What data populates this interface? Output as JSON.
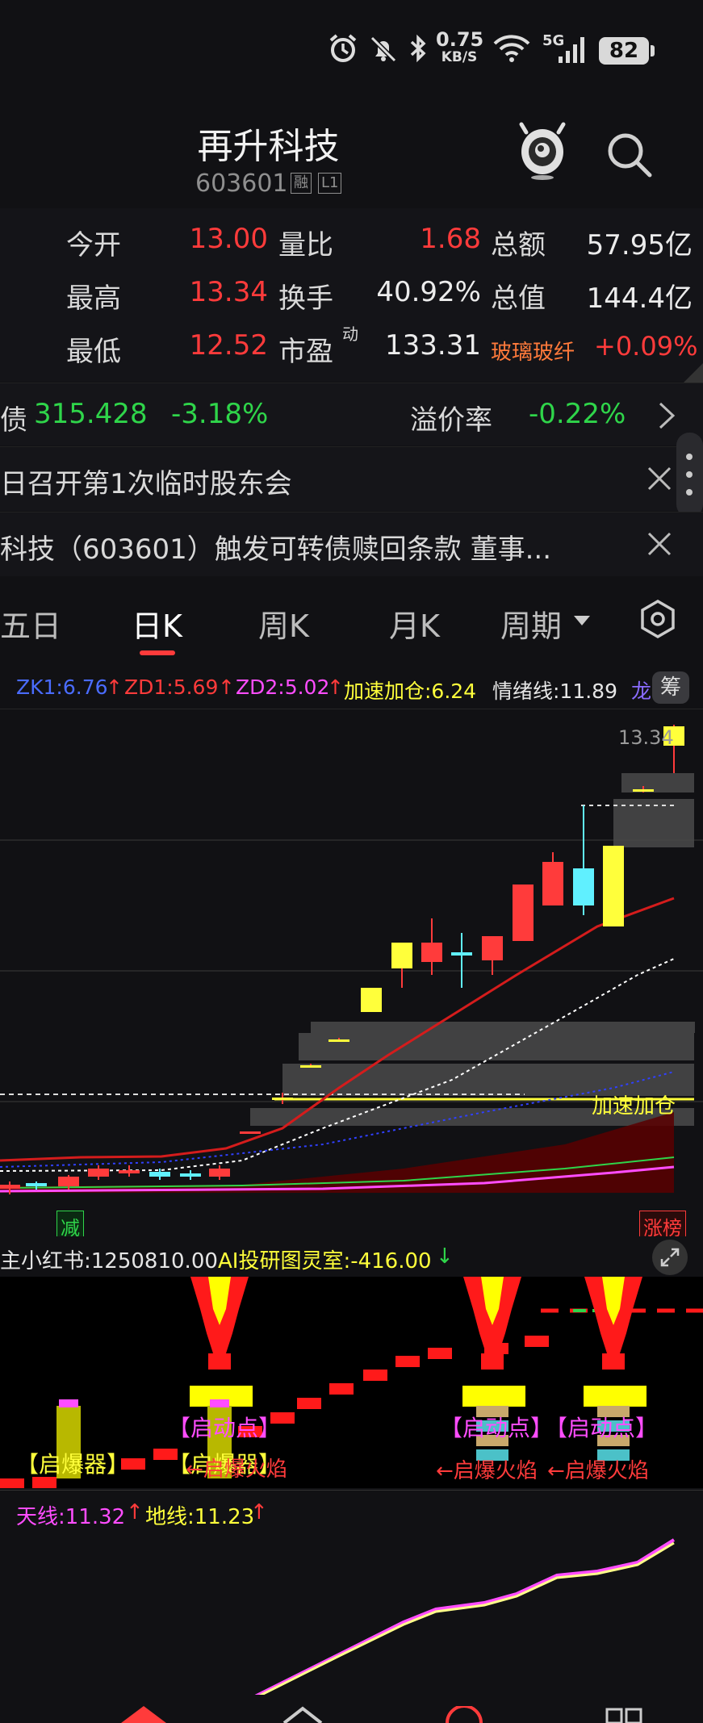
{
  "status_bar": {
    "net_speed": "0.75",
    "net_unit": "KB/S",
    "signal": "5G",
    "battery": "82"
  },
  "header": {
    "title": "再升科技",
    "code": "603601",
    "tag1": "融",
    "tag2": "L1"
  },
  "quotes": {
    "open_label": "今开",
    "open": "13.00",
    "vol_ratio_label": "量比",
    "vol_ratio": "1.68",
    "amount_label": "总额",
    "amount": "57.95亿",
    "high_label": "最高",
    "high": "13.34",
    "turnover_label": "换手",
    "turnover": "40.92%",
    "mktcap_label": "总值",
    "mktcap": "144.4亿",
    "low_label": "最低",
    "low": "12.52",
    "pe_label": "市盈",
    "pe_sup": "动",
    "pe": "133.31",
    "sector": "玻璃玻纤",
    "sector_change": "+0.09%"
  },
  "bond": {
    "prefix": "债",
    "price": "315.428",
    "change": "-3.18%",
    "premium_label": "溢价率",
    "premium": "-0.22%"
  },
  "news": [
    {
      "text": "日召开第1次临时股东会"
    },
    {
      "text": "科技（603601）触发可转债赎回条款 董事..."
    }
  ],
  "tabs": [
    {
      "label": "五日"
    },
    {
      "label": "日K"
    },
    {
      "label": "周K"
    },
    {
      "label": "月K"
    },
    {
      "label": "周期"
    }
  ],
  "legend_main": {
    "zk": "ZK1:6.76",
    "zd1": "ZD1:5.69",
    "zd2": "ZD2:5.02",
    "accel": "加速加仓:6.24",
    "mood": "情绪线:11.89",
    "dragon": "龙",
    "chip_btn": "筹",
    "up_arrow": "↑"
  },
  "chart_main_labels": {
    "high_mark": "13.34",
    "accel_label": "加速加仓",
    "reduce_badge": "减",
    "rank_badge": "涨榜"
  },
  "legend_ind": {
    "main": "主小红书:1250810.00",
    "ai": "AI投研图灵室:-416.00",
    "down_arrow": "↓"
  },
  "ind_labels": {
    "qibaoqi": "【启爆器】",
    "qidongdian": "【启动点】",
    "flame": "←启爆火焰"
  },
  "legend_bottom": {
    "tian": "天线:11.32",
    "di": "地线:11.23",
    "up_arrow": "↑"
  },
  "colors": {
    "up": "#ff3b3b",
    "down": "#2fd54a",
    "yellow": "#ffff00",
    "cyan": "#60f0ff",
    "magenta": "#ff4dff",
    "blue": "#4a5cff"
  }
}
